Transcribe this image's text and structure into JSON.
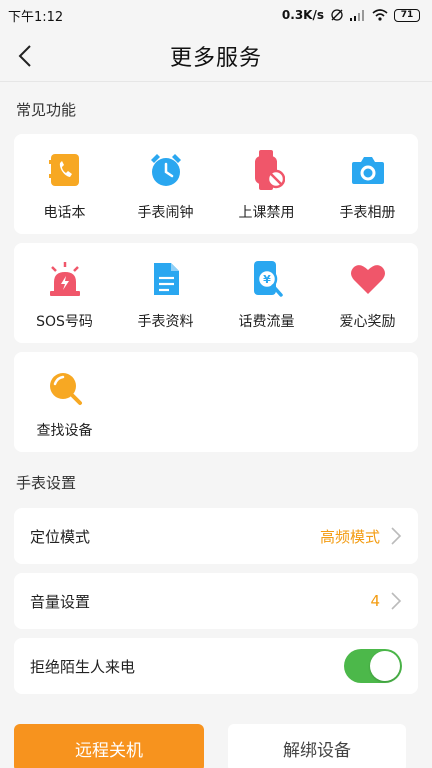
{
  "status_bar": {
    "time": "下午1:12",
    "network_speed": "0.3K/s",
    "battery": "71"
  },
  "header": {
    "title": "更多服务"
  },
  "common": {
    "section_title": "常见功能",
    "items": [
      {
        "label": "电话本",
        "icon": "phonebook-icon",
        "color": "#f7a823"
      },
      {
        "label": "手表闹钟",
        "icon": "alarm-clock-icon",
        "color": "#2aa7f0"
      },
      {
        "label": "上课禁用",
        "icon": "watch-disabled-icon",
        "color": "#f0566a"
      },
      {
        "label": "手表相册",
        "icon": "camera-icon",
        "color": "#2aa7f0"
      },
      {
        "label": "SOS号码",
        "icon": "sos-alarm-icon",
        "color": "#f0566a"
      },
      {
        "label": "手表资料",
        "icon": "document-icon",
        "color": "#2aa7f0"
      },
      {
        "label": "话费流量",
        "icon": "phone-bill-icon",
        "color": "#2aa7f0"
      },
      {
        "label": "爱心奖励",
        "icon": "heart-icon",
        "color": "#f0566a"
      },
      {
        "label": "查找设备",
        "icon": "find-device-icon",
        "color": "#f7a823"
      }
    ]
  },
  "watch_settings": {
    "section_title": "手表设置",
    "location_mode": {
      "label": "定位模式",
      "value": "高频模式"
    },
    "volume": {
      "label": "音量设置",
      "value": "4"
    },
    "reject_strangers": {
      "label": "拒绝陌生人来电",
      "enabled": true
    }
  },
  "actions": {
    "remote_shutdown": "远程关机",
    "unbind": "解绑设备"
  },
  "colors": {
    "accent": "#f7931e",
    "value": "#f39c12",
    "toggle_on": "#4cb84a"
  }
}
